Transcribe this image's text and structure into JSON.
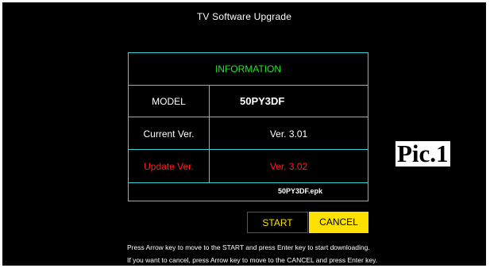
{
  "screen": {
    "title": "TV Software Upgrade"
  },
  "info": {
    "header": "INFORMATION",
    "model_label": "MODEL",
    "model_value": "50PY3DF",
    "current_label": "Current Ver.",
    "current_value": "Ver. 3.01",
    "update_label": "Update Ver.",
    "update_value": "Ver. 3.02",
    "file_name": "50PY3DF.epk"
  },
  "buttons": {
    "start_label": "START",
    "cancel_label": "CANCEL"
  },
  "help": {
    "line1": "Press Arrow key to move to the START and press Enter key to start downloading.",
    "line2": "If you want to cancel, press Arrow key to move to the CANCEL and press Enter key."
  },
  "overlay": {
    "pic_label": "Pic.1"
  },
  "colors": {
    "border": "#3fd2d2",
    "header_text": "#22e32a",
    "update_text": "#ff2020",
    "cancel_bg": "#ffe100",
    "start_text": "#ffe100"
  }
}
